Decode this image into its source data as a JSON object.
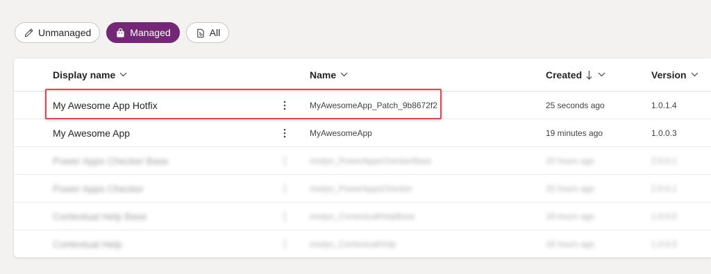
{
  "filters": {
    "unmanaged": "Unmanaged",
    "managed": "Managed",
    "all": "All"
  },
  "columns": {
    "display_name": "Display name",
    "name": "Name",
    "created": "Created",
    "version": "Version"
  },
  "rows": [
    {
      "display_name": "My Awesome App Hotfix",
      "name": "MyAwesomeApp_Patch_9b8672f2",
      "created": "25 seconds ago",
      "version": "1.0.1.4"
    },
    {
      "display_name": "My Awesome App",
      "name": "MyAwesomeApp",
      "created": "19 minutes ago",
      "version": "1.0.0.3"
    },
    {
      "display_name": "Power Apps Checker Base",
      "name": "msdyn_PowerAppsCheckerBase",
      "created": "15 hours ago",
      "version": "2.0.0.1"
    },
    {
      "display_name": "Power Apps Checker",
      "name": "msdyn_PowerAppsChecker",
      "created": "15 hours ago",
      "version": "2.0.0.1"
    },
    {
      "display_name": "Contextual Help Base",
      "name": "msdyn_ContextualHelpBase",
      "created": "18 hours ago",
      "version": "1.0.0.0"
    },
    {
      "display_name": "Contextual Help",
      "name": "msdyn_ContextualHelp",
      "created": "18 hours ago",
      "version": "1.0.0.0"
    }
  ],
  "colors": {
    "accent": "#742774",
    "highlight": "#e0474c"
  }
}
